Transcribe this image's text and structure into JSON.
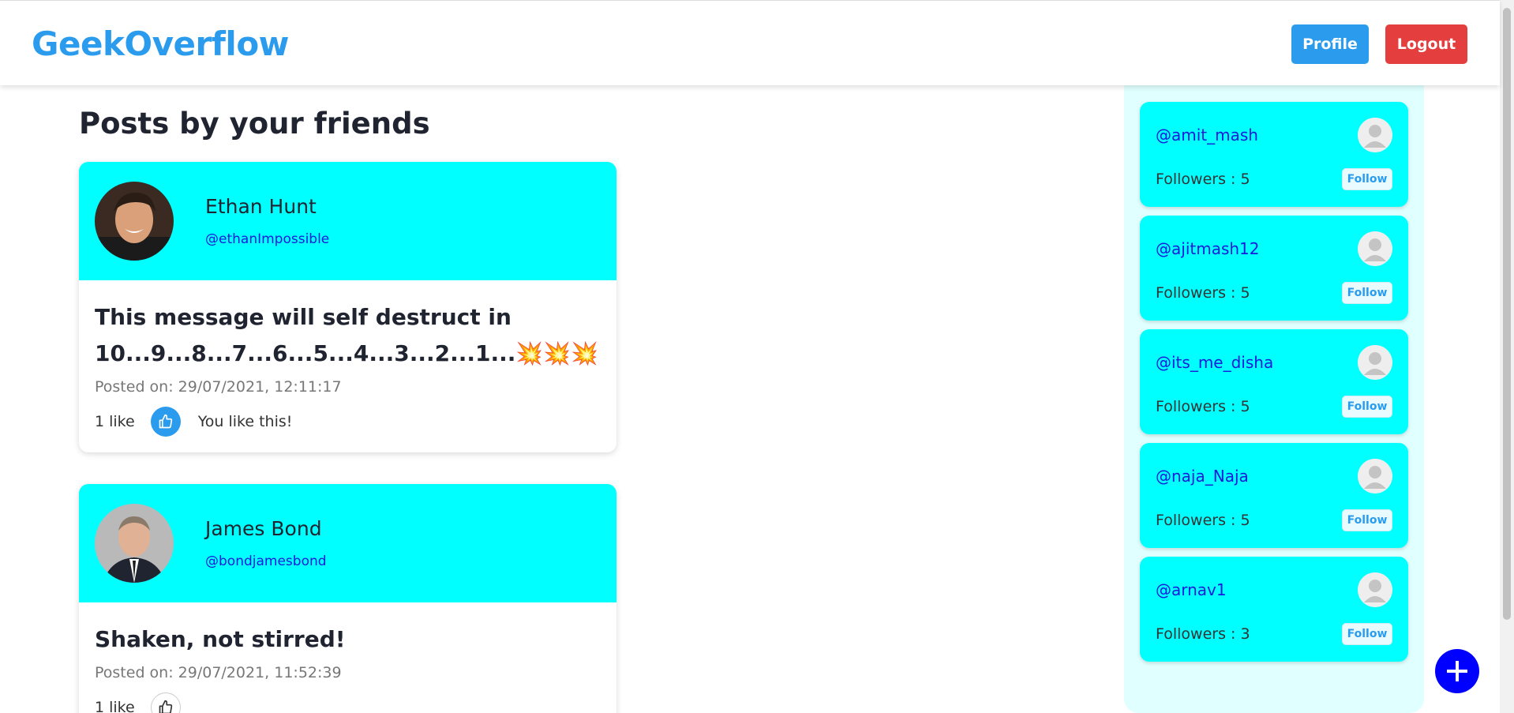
{
  "header": {
    "brand": "GeekOverflow",
    "profile_label": "Profile",
    "logout_label": "Logout"
  },
  "main": {
    "title": "Posts by your friends",
    "posts": [
      {
        "name": "Ethan Hunt",
        "handle": "@ethanImpossible",
        "text": "This message will self destruct in 10...9...8...7...6...5...4...3...2...1...💥💥💥",
        "date": "Posted on: 29/07/2021, 12:11:17",
        "likes": "1 like",
        "like_message": "You like this!"
      },
      {
        "name": "James Bond",
        "handle": "@bondjamesbond",
        "text": "Shaken, not stirred!",
        "date": "Posted on: 29/07/2021, 11:52:39",
        "likes": "1 like"
      }
    ]
  },
  "sidebar": {
    "users": [
      {
        "handle": "@amit_mash",
        "followers": "Followers : 5",
        "follow_label": "Follow"
      },
      {
        "handle": "@ajitmash12",
        "followers": "Followers : 5",
        "follow_label": "Follow"
      },
      {
        "handle": "@its_me_disha",
        "followers": "Followers : 5",
        "follow_label": "Follow"
      },
      {
        "handle": "@naja_Naja",
        "followers": "Followers : 5",
        "follow_label": "Follow"
      },
      {
        "handle": "@arnav1",
        "followers": "Followers : 3",
        "follow_label": "Follow"
      }
    ]
  },
  "icons": {
    "like": "thumbs-up-icon",
    "add": "plus-icon",
    "user": "user-avatar-icon"
  },
  "colors": {
    "brand": "#2b9ced",
    "logout": "#e53e3e",
    "card_header": "#00ffff",
    "sidebar_bg": "#e0ffff",
    "fab": "#0000ff",
    "handle": "#1a1adb"
  }
}
